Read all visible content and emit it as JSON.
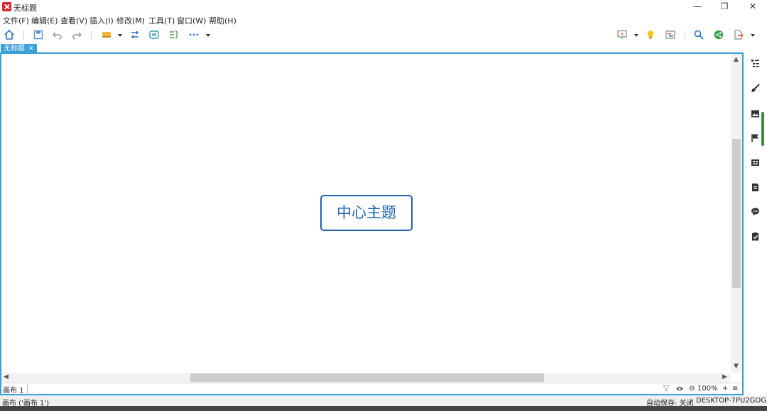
{
  "window": {
    "title": "无标题",
    "min_glyph": "—",
    "restore_glyph": "❐",
    "close_glyph": "✕"
  },
  "menu": [
    "文件(F)",
    "编辑(E)",
    "查看(V)",
    "插入(I)",
    "修改(M)",
    "工具(T)",
    "窗口(W)",
    "帮助(H)"
  ],
  "tab": {
    "label": "无标题",
    "close_glyph": "✕"
  },
  "canvas": {
    "central_topic": "中心主题"
  },
  "sheetbar": {
    "sheet_label": "画布 1",
    "zoom_out_glyph": "⊖",
    "zoom_level": "100%",
    "zoom_in_glyph": "+",
    "menu_glyph": "≡"
  },
  "statusbar": {
    "sheet_info": "画布 ('画布 1')",
    "autosave": "自动保存: 关闭",
    "computer": "DESKTOP-7PU2GOG"
  },
  "colors": {
    "accent": "#3b9fd9",
    "topic_border": "#1f62b1",
    "brand_red": "#d9242a"
  }
}
